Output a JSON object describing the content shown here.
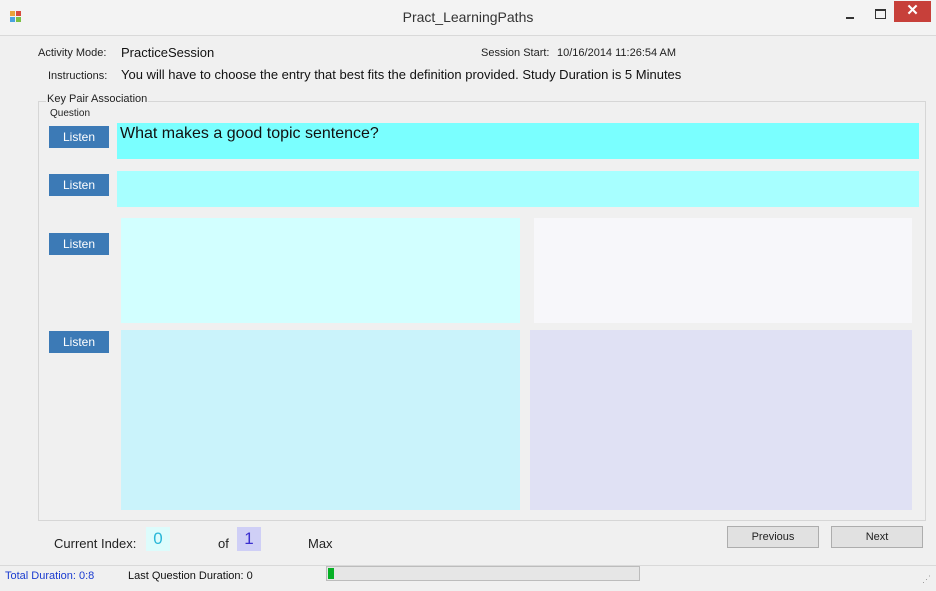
{
  "window": {
    "title": "Pract_LearningPaths",
    "close_glyph": "✕"
  },
  "header": {
    "activity_mode_label": "Activity Mode:",
    "activity_mode_value": "PracticeSession",
    "session_start_label": "Session Start:",
    "session_start_value": "10/16/2014 11:26:54 AM",
    "instructions_label": "Instructions:",
    "instructions_value": "You will have to choose the entry that best fits the definition provided.  Study Duration is 5 Minutes"
  },
  "group": {
    "label": "Key Pair Association",
    "question_label": "Question",
    "question_text": "What makes a good topic sentence?",
    "listen_label": "Listen"
  },
  "nav": {
    "current_index_label": "Current Index:",
    "current_index_value": "0",
    "of_label": "of",
    "total_value": "1",
    "max_label": "Max",
    "previous_label": "Previous",
    "next_label": "Next"
  },
  "status": {
    "total_duration": "Total Duration: 0:8",
    "last_question_duration": "Last Question Duration: 0",
    "progress_fraction": 0.018
  },
  "colors": {
    "question_box": "#7affff",
    "answer_box": "#a7ffff",
    "option_a": "#d2ffff",
    "option_b": "#f7f7fa",
    "option_c": "#caf3fb",
    "option_d": "#e0e1f4",
    "listen_button": "#3c7ab6",
    "current_index_bg": "#ddfcfc",
    "total_bg": "#cfcff6",
    "progress_green": "#06b025",
    "status_blue": "#1a3bd0"
  }
}
